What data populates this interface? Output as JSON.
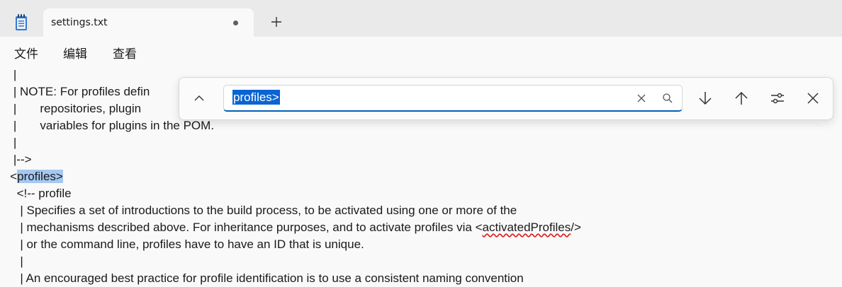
{
  "tab": {
    "title": "settings.txt"
  },
  "menu": {
    "file": "文件",
    "edit": "编辑",
    "view": "查看"
  },
  "find": {
    "query": "profiles>"
  },
  "editor": {
    "lines": [
      "    |",
      "    | NOTE: For profiles defin",
      "    |       repositories, plugin",
      "    |       variables for plugins in the POM.",
      "    |",
      "    |-->",
      "   <",
      "     <!-- profile",
      "      | Specifies a set of introductions to the build process, to be activated using one or more of the",
      "      | mechanisms described above. For inheritance purposes, and to activate profiles via <",
      "      | or the command line, profiles have to have an ID that is unique.",
      "      |",
      "      | An encouraged best practice for profile identification is to use a consistent naming convention"
    ],
    "highlight": "profiles>",
    "activated_tag": "activatedProfiles",
    "activated_tail": "/>"
  }
}
